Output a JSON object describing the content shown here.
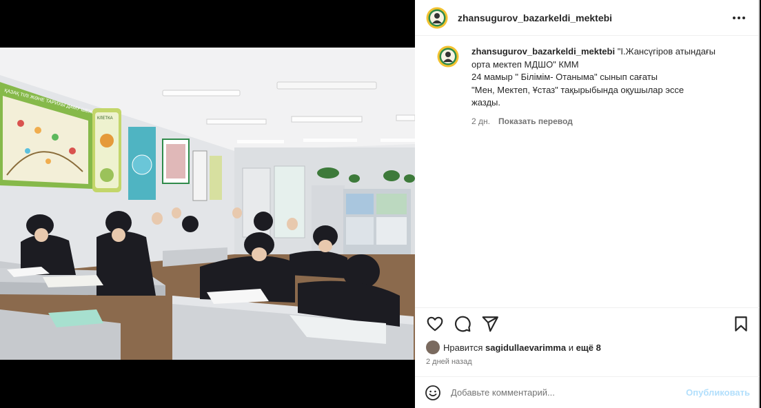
{
  "account": {
    "username": "zhansugurov_bazarkeldi_mektebi"
  },
  "post": {
    "caption_lines": [
      "\"I.Жансүгіров атындағы",
      "орта мектеп МДШО\" КММ",
      "24 мамыр \" Білімім- Отаныма\" сынып сағаты",
      "\"Мен, Мектеп, Ұстаз\" тақырыбында оқушылар эссе",
      "жазды."
    ],
    "age": "2 дн.",
    "translate_label": "Показать перевод"
  },
  "photo": {
    "banner_text": "ҚАЗАҚ ТІЛІ ЖӘНЕ ТАРИХЫ ДАМУ ШЕЖІРЕСІ",
    "poster_label": "КЛЕТКА"
  },
  "likes": {
    "prefix": "Нравится",
    "user": "sagidullaevarimma",
    "joiner": "и",
    "others": "ещё 8"
  },
  "timestamp": "2 дней назад",
  "comment": {
    "placeholder": "Добавьте комментарий...",
    "post_label": "Опубликовать"
  },
  "icons": [
    "school-logo-icon",
    "more-options-icon",
    "heart-icon",
    "comment-icon",
    "share-icon",
    "bookmark-icon",
    "emoji-icon"
  ],
  "colors": {
    "text": "#262626",
    "muted": "#737373",
    "post_button": "#b2dffc",
    "logo_ring": "#f2c230"
  }
}
